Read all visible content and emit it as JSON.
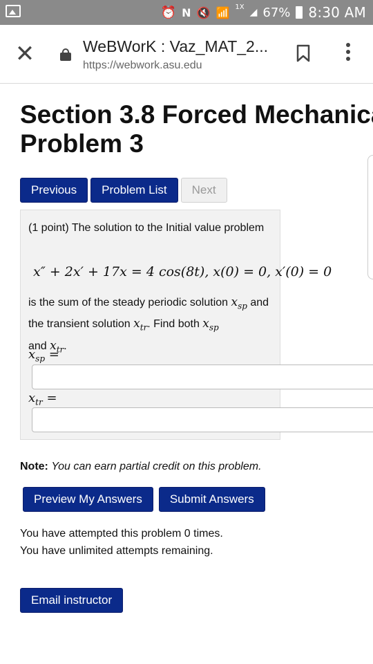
{
  "status_bar": {
    "battery": "67%",
    "time": "8:30 AM",
    "signal_label": "1X"
  },
  "browser": {
    "title": "WeBWorK : Vaz_MAT_2...",
    "url": "https://webwork.asu.edu"
  },
  "page": {
    "title_line1": "Section 3.8 Forced Mechanica",
    "title_line2": "Problem 3"
  },
  "nav": {
    "previous": "Previous",
    "problem_list": "Problem List",
    "next": "Next"
  },
  "problem": {
    "intro": "(1 point) The solution to the Initial value problem",
    "equation": "x″ + 2x′ + 17x = 4 cos(8t),    x(0) = 0, x′(0) = 0",
    "text_1": "is the sum of the steady periodic solution ",
    "text_2": " and the transient solution ",
    "text_3": ". Find both ",
    "text_4": " and ",
    "var_x": "x",
    "sub_sp": "sp",
    "sub_tr": "tr",
    "label_sp_eq": " =",
    "label_tr_eq": " ="
  },
  "inputs": {
    "xsp_value": "",
    "xtr_value": ""
  },
  "note": {
    "label": "Note:",
    "text": "You can earn partial credit on this problem."
  },
  "actions": {
    "preview": "Preview My Answers",
    "submit": "Submit Answers"
  },
  "attempts": {
    "line1": "You have attempted this problem 0 times.",
    "line2": "You have unlimited attempts remaining."
  },
  "email": {
    "label": "Email instructor"
  },
  "colors": {
    "button_bg": "#0b2a8a",
    "status_bar_bg": "#8a8a8a",
    "problem_bg": "#f2f2f2"
  }
}
